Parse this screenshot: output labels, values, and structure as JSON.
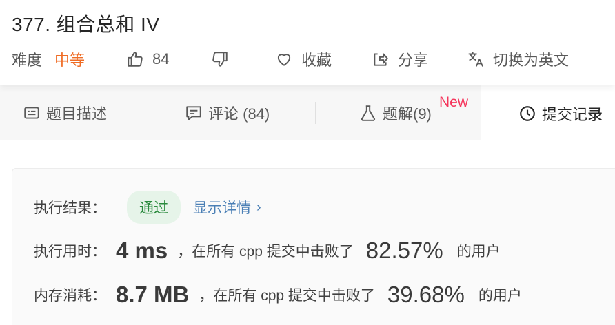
{
  "problem": {
    "title": "377. 组合总和 IV",
    "difficulty_label": "难度",
    "difficulty_value": "中等",
    "likes": "84",
    "favorite_label": "收藏",
    "share_label": "分享",
    "translate_label": "切换为英文"
  },
  "tabs": [
    {
      "label": "题目描述"
    },
    {
      "label": "评论 (84)"
    },
    {
      "label": "题解(9)"
    },
    {
      "label": "提交记录"
    }
  ],
  "new_badge": "New",
  "result": {
    "status_label": "执行结果：",
    "status_value": "通过",
    "details_link": "显示详情",
    "runtime_label": "执行用时：",
    "runtime_value": "4 ms",
    "runtime_mid": "，在所有 cpp 提交中击败了",
    "runtime_pct": "82.57%",
    "runtime_tail": "的用户",
    "memory_label": "内存消耗：",
    "memory_value": "8.7 MB",
    "memory_mid": "，在所有 cpp 提交中击败了",
    "memory_pct": "39.68%",
    "memory_tail": "的用户"
  },
  "colors": {
    "difficulty_medium": "#ef6c25",
    "new_badge": "#f5365c",
    "success_text": "#2b8a3e",
    "success_bg": "#e6f4e9",
    "link": "#4a7fb5"
  },
  "icons": [
    "thumbs-up-icon",
    "thumbs-down-icon",
    "heart-icon",
    "share-icon",
    "translate-icon",
    "description-icon",
    "comment-icon",
    "flask-icon",
    "clock-icon",
    "chevron-right-icon"
  ]
}
